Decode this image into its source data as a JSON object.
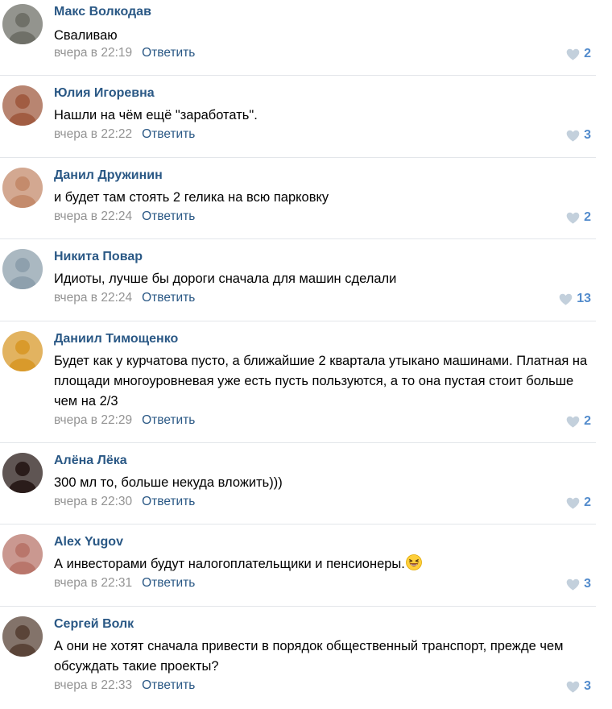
{
  "reply_label": "Ответить",
  "comments": [
    {
      "author": "Макс Волкодав",
      "text": "Сваливаю",
      "time": "вчера в 22:19",
      "likes": "2",
      "avatar_color": "#6f7068"
    },
    {
      "author": "Юлия Игоревна",
      "text": "Нашли на чём ещё \"заработать\".",
      "time": "вчера в 22:22",
      "likes": "3",
      "avatar_color": "#a15c42"
    },
    {
      "author": "Данил Дружинин",
      "text": "и будет там стоять 2 гелика на всю парковку",
      "time": "вчера в 22:24",
      "likes": "2",
      "avatar_color": "#c48b6c"
    },
    {
      "author": "Никита Повар",
      "text": "Идиоты, лучше бы дороги сначала для машин сделали",
      "time": "вчера в 22:24",
      "likes": "13",
      "avatar_color": "#8ea0ad"
    },
    {
      "author": "Даниил Тимощенко",
      "text": "Будет как у курчатова пусто, а ближайшие 2 квартала утыкано машинами. Платная на площади многоуровневая уже есть пусть пользуются, а то она пустая стоит больше чем на 2/3",
      "time": "вчера в 22:29",
      "likes": "2",
      "avatar_color": "#d99a2b"
    },
    {
      "author": "Алёна Лёка",
      "text": "300 мл то, больше некуда вложить)))",
      "time": "вчера в 22:30",
      "likes": "2",
      "avatar_color": "#2a1c1a"
    },
    {
      "author": "Alex Yugov",
      "text": "А инвесторами будут налогоплательщики и пенсионеры.",
      "time": "вчера в 22:31",
      "likes": "3",
      "avatar_color": "#b9766b",
      "emoji": "laughing-face-emoji"
    },
    {
      "author": "Сергей Волк",
      "text": "А они не хотят сначала привести в порядок общественный транспорт, прежде чем обсуждать такие проекты?",
      "time": "вчера в 22:33",
      "likes": "3",
      "avatar_color": "#5a4438"
    }
  ]
}
